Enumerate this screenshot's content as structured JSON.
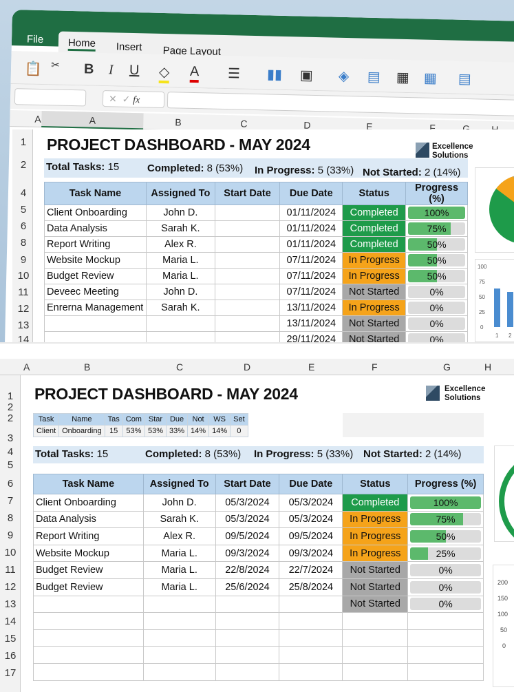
{
  "top": {
    "ribbon_tabs": [
      "File",
      "Home",
      "Insert",
      "Page Layout"
    ],
    "toolbar": {
      "bold": "B",
      "italic": "I",
      "underline": "U",
      "font_color": "A",
      "fx": "fx"
    },
    "columns": [
      "A",
      "A",
      "B",
      "C",
      "D",
      "E",
      "F",
      "G",
      "H"
    ],
    "row_numbers": [
      "1",
      "2",
      "4",
      "5",
      "6",
      "8",
      "9",
      "10",
      "11",
      "12",
      "13",
      "14"
    ],
    "title": "PROJECT DASHBOARD - MAY 2024",
    "logo": [
      "Excellence",
      "Solutions"
    ],
    "summary": {
      "total_label": "Total Tasks:",
      "total": "15",
      "completed_label": "Completed:",
      "completed": "8 (53%)",
      "inprogress_label": "In Progress:",
      "inprogress": "5 (33%)",
      "notstarted_label": "Not Started:",
      "notstarted": "2 (14%)"
    },
    "headers": [
      "Task Name",
      "Assigned To",
      "Start Date",
      "Due Date",
      "Status",
      "Progress (%)"
    ],
    "rows": [
      {
        "task": "Client Onboarding",
        "who": "John D.",
        "start": "",
        "due": "01/11/2024",
        "status": "Completed",
        "progress": 100
      },
      {
        "task": "Data Analysis",
        "who": "Sarah K.",
        "start": "",
        "due": "01/11/2024",
        "status": "Completed",
        "progress": 75
      },
      {
        "task": "Report Writing",
        "who": "Alex R.",
        "start": "",
        "due": "01/11/2024",
        "status": "Completed",
        "progress": 50
      },
      {
        "task": "Website Mockup",
        "who": "Maria L.",
        "start": "",
        "due": "07/11/2024",
        "status": "In Progress",
        "progress": 50
      },
      {
        "task": "Budget Review",
        "who": "Maria L.",
        "start": "",
        "due": "07/11/2024",
        "status": "In Progress",
        "progress": 50
      },
      {
        "task": "Deveec Meeting",
        "who": "John D.",
        "start": "",
        "due": "07/11/2024",
        "status": "Not Started",
        "progress": 0
      },
      {
        "task": "Enrerna Management",
        "who": "Sarah K.",
        "start": "",
        "due": "13/11/2024",
        "status": "In Progress",
        "progress": 0
      },
      {
        "task": "",
        "who": "",
        "start": "",
        "due": "13/11/2024",
        "status": "Not Started",
        "progress": 0
      },
      {
        "task": "",
        "who": "",
        "start": "",
        "due": "29/11/2024",
        "status": "Not Started",
        "progress": 0
      }
    ],
    "bar_axis": [
      "100",
      "75",
      "50",
      "25",
      "0"
    ],
    "bar_x": [
      "1",
      "2"
    ]
  },
  "bottom": {
    "columns": [
      "A",
      "B",
      "C",
      "D",
      "E",
      "F",
      "G",
      "H"
    ],
    "row_numbers": [
      "1",
      "2",
      "2",
      "3",
      "4",
      "5",
      "6",
      "7",
      "8",
      "9",
      "10",
      "11",
      "12",
      "13",
      "14",
      "15",
      "16",
      "17"
    ],
    "title": "PROJECT DASHBOARD - MAY 2024",
    "logo": [
      "Excellence",
      "Solutions"
    ],
    "mini_table": [
      [
        "Task",
        "Name",
        "Tas",
        "Com",
        "Star",
        "Due",
        "Not",
        "WS",
        "Set"
      ],
      [
        "Client",
        "Onboarding",
        "15",
        "53%",
        "53%",
        "33%",
        "14%",
        "14%",
        "0"
      ]
    ],
    "summary": {
      "total_label": "Total Tasks:",
      "total": "15",
      "completed_label": "Completed:",
      "completed": "8 (53%)",
      "inprogress_label": "In Progress:",
      "inprogress": "5 (33%)",
      "notstarted_label": "Not Started:",
      "notstarted": "2 (14%)"
    },
    "headers": [
      "Task Name",
      "Assigned To",
      "Start Date",
      "Due Date",
      "Status",
      "Progress (%)"
    ],
    "rows": [
      {
        "task": "Client Onboarding",
        "who": "John D.",
        "start": "05/3/2024",
        "due": "05/3/2024",
        "status": "Completed",
        "progress": 100
      },
      {
        "task": "Data Analysis",
        "who": "Sarah K.",
        "start": "05/3/2024",
        "due": "05/3/2024",
        "status": "In Progress",
        "progress": 75
      },
      {
        "task": "Report Writing",
        "who": "Alex R.",
        "start": "09/5/2024",
        "due": "09/5/2024",
        "status": "In Progress",
        "progress": 50
      },
      {
        "task": "Website Mockup",
        "who": "Maria L.",
        "start": "09/3/2024",
        "due": "09/3/2024",
        "status": "In Progress",
        "progress": 25
      },
      {
        "task": "Budget Review",
        "who": "Maria L.",
        "start": "22/8/2024",
        "due": "22/7/2024",
        "status": "Not Started",
        "progress": 0
      },
      {
        "task": "Budget Review",
        "who": "Maria L.",
        "start": "25/6/2024",
        "due": "25/8/2024",
        "status": "Not Started",
        "progress": 0
      },
      {
        "task": "",
        "who": "",
        "start": "",
        "due": "",
        "status": "Not Started",
        "progress": 0
      },
      {
        "task": "",
        "who": "",
        "start": "",
        "due": "",
        "status": "",
        "progress": null
      },
      {
        "task": "",
        "who": "",
        "start": "",
        "due": "",
        "status": "",
        "progress": null
      },
      {
        "task": "",
        "who": "",
        "start": "",
        "due": "",
        "status": "",
        "progress": null
      },
      {
        "task": "",
        "who": "",
        "start": "",
        "due": "",
        "status": "",
        "progress": null
      }
    ],
    "bar_axis": [
      "200",
      "150",
      "100",
      "50",
      "0"
    ]
  },
  "colors": {
    "completed": "#1e9b4a",
    "in_progress": "#f5a31a",
    "not_started": "#a8a8a8",
    "header": "#bcd6ee",
    "ribbon": "#1f6e43"
  }
}
